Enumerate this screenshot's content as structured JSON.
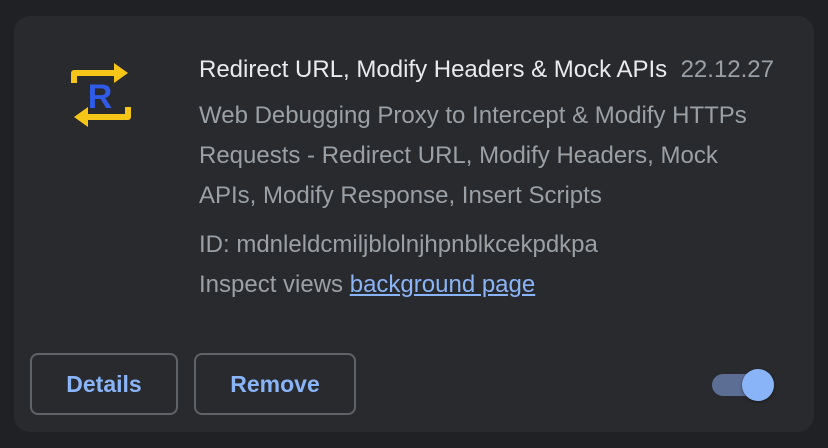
{
  "extension": {
    "icon": "requestly-redirect-icon",
    "icon_letter": "R",
    "icon_colors": {
      "arrows": "#f5c518",
      "letter": "#2f5be7"
    },
    "title": "Redirect URL, Modify Headers & Mock APIs",
    "version": "22.12.27",
    "description": "Web Debugging Proxy to Intercept & Modify HTTPs Requests - Redirect URL, Modify Headers, Mock APIs, Modify Response, Insert Scripts",
    "id_label": "ID: mdnleldcmiljblolnjhpnblkcekpdkpa",
    "inspect_label": "Inspect views",
    "inspect_link": "background page",
    "enabled": true
  },
  "buttons": {
    "details": "Details",
    "remove": "Remove"
  },
  "colors": {
    "background": "#202124",
    "card": "#292a2d",
    "accent": "#8ab4f8",
    "text_primary": "#e8eaed",
    "text_secondary": "#9aa0a6"
  }
}
